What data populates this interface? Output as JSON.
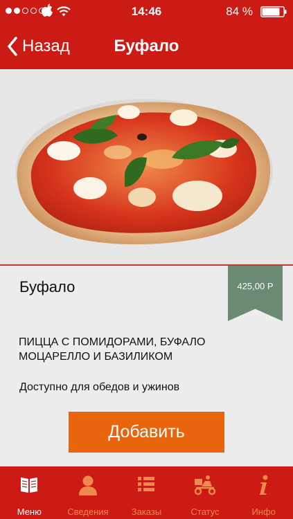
{
  "status": {
    "time": "14:46",
    "battery": "84 %",
    "signal_filled": 2,
    "signal_total": 5
  },
  "nav": {
    "back_label": "Назад",
    "title": "Буфало"
  },
  "product": {
    "image": "pizza-photo",
    "name": "Буфало",
    "price": "425,00 Р",
    "description": "ПИЦЦА С ПОМИДОРАМИ, БУФАЛО МОЦАРЕЛЛО И БАЗИЛИКОМ",
    "availability": "Доступно для обедов и ужинов",
    "add_label": "Добавить"
  },
  "tabs": [
    {
      "label": "Меню",
      "icon": "book-icon",
      "active": true
    },
    {
      "label": "Сведения",
      "icon": "person-icon",
      "active": false
    },
    {
      "label": "Заказы",
      "icon": "list-icon",
      "active": false
    },
    {
      "label": "Статус",
      "icon": "delivery-scooter-icon",
      "active": false
    },
    {
      "label": "Инфо",
      "icon": "info-icon",
      "active": false
    }
  ],
  "colors": {
    "brand_red": "#cc1a14",
    "add_button": "#e8650e",
    "price_ribbon": "#6b8a73",
    "tab_inactive": "#ee8a4d"
  }
}
